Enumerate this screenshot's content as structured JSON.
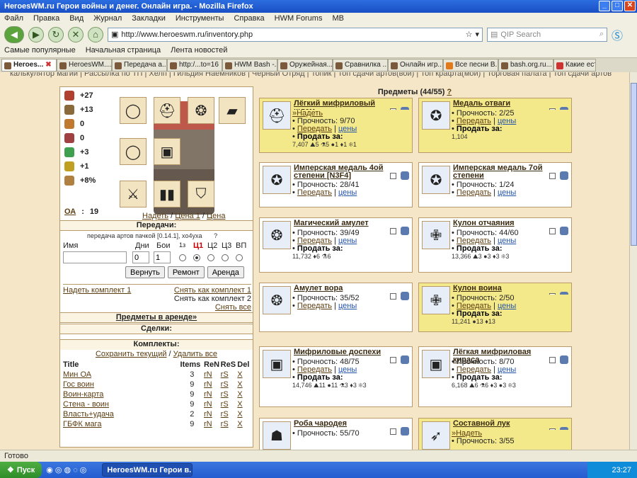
{
  "window": {
    "title": "HeroesWM.ru Герои войны и денег. Онлайн игра. - Mozilla Firefox"
  },
  "menu": [
    "Файл",
    "Правка",
    "Вид",
    "Журнал",
    "Закладки",
    "Инструменты",
    "Справка",
    "HWM Forums",
    "MB"
  ],
  "nav": {
    "url": "http://www.heroeswm.ru/inventory.php",
    "search_placeholder": "QIP Search"
  },
  "bookmarks": [
    "Самые популярные",
    "Начальная страница",
    "Лента новостей"
  ],
  "tabs": [
    "Heroes...",
    "HeroesWM....",
    "Передача а...",
    "http:/...to=16",
    "HWM Bash -...",
    "Оружейная...",
    "Сравнилка ...",
    "Онлайн игр...",
    "Все песни В...",
    "bash.org.ru...",
    "Какие ест"
  ],
  "toplinks": "калькулятор магии | Рассылка по ТП | Хелп | Гильдия Наемников | Черный Отряд | Топик | Топ сдачи артов(вои) | Топ крафта(мои) | Торговая палата | Топ сдачи артов",
  "stats": [
    {
      "icon": "attack-icon",
      "value": "+27",
      "color": "#b04030"
    },
    {
      "icon": "defense-icon",
      "value": "+13",
      "color": "#8a6a3a"
    },
    {
      "icon": "spellpower-icon",
      "value": "0",
      "color": "#c07a30"
    },
    {
      "icon": "knowledge-icon",
      "value": "0",
      "color": "#a04040"
    },
    {
      "icon": "luck-icon",
      "value": "+3",
      "color": "#40a050"
    },
    {
      "icon": "morale-icon",
      "value": "+1",
      "color": "#c0a020"
    },
    {
      "icon": "initiative-icon",
      "value": "+8%",
      "color": "#b08040"
    }
  ],
  "oa": {
    "label": "ОА",
    "value": "19"
  },
  "hero_links": {
    "wear": "Надеть",
    "price": "Цена 1",
    "price2": "Цена"
  },
  "transfer": {
    "title": "Передачи:",
    "note": "передача артов пачкой [0.14.1], xo4yxa",
    "help": "?",
    "name_label": "Имя",
    "days_label": "Дни",
    "fights_label": "Бои",
    "c1": "1з",
    "c2": "Ц1",
    "c3": "Ц2",
    "c4": "Ц3",
    "c5": "ВП",
    "days_value": "0",
    "fights_value": "1",
    "btn_return": "Вернуть",
    "btn_repair": "Ремонт",
    "btn_rent": "Аренда"
  },
  "kits_top": {
    "wear_kit": "Надеть комплект 1",
    "take_off1": "Снять как комплект 1",
    "take_off2": "Снять как комплект 2",
    "take_off_all": "Снять все"
  },
  "arena": "Предметы в аренде»",
  "deals": "Сделки:",
  "kits": {
    "title": "Комплекты:",
    "save": "Сохранить текущий",
    "delete_all": "Удалить все",
    "headers": [
      "Title",
      "Items",
      "ReN",
      "ReS",
      "Del"
    ],
    "rows": [
      {
        "title": "Мин ОА",
        "items": "3",
        "ren": "rN",
        "res": "rS",
        "del": "X"
      },
      {
        "title": "Гос воин",
        "items": "9",
        "ren": "rN",
        "res": "rS",
        "del": "X"
      },
      {
        "title": "Воин-карта",
        "items": "9",
        "ren": "rN",
        "res": "rS",
        "del": "X"
      },
      {
        "title": "Стена - воин",
        "items": "9",
        "ren": "rN",
        "res": "rS",
        "del": "X"
      },
      {
        "title": "Власть+удача",
        "items": "2",
        "ren": "rN",
        "res": "rS",
        "del": "X"
      },
      {
        "title": "ГБФК мага",
        "items": "9",
        "ren": "rN",
        "res": "rS",
        "del": "X"
      }
    ]
  },
  "items_title": "Предметы (44/55)",
  "items_help": "?",
  "items": [
    {
      "name": "Лёгкий мифриловый шлем",
      "wear": "»Надеть",
      "durability": "Прочность: 9/70",
      "transfer": "Передать",
      "prices": "цены",
      "sell": "Продать за:",
      "res": "7,407 ⛰5 ⚗5 ●1 ♦1 ❄1",
      "yellow": true,
      "icon": "helmet-icon"
    },
    {
      "name": "Медаль отваги",
      "wear": "",
      "durability": "Прочность: 2/25",
      "transfer": "Передать",
      "prices": "цены",
      "sell": "Продать за:",
      "res": "1,104",
      "yellow": true,
      "icon": "medal-icon"
    },
    {
      "name": "Имперская медаль 4ой степени [N3F4]",
      "wear": "",
      "durability": "Прочность: 28/41",
      "transfer": "Передать",
      "prices": "цены",
      "sell": "",
      "res": "",
      "yellow": false,
      "icon": "medal-icon"
    },
    {
      "name": "Имперская медаль 7ой степени",
      "wear": "",
      "durability": "Прочность: 1/24",
      "transfer": "Передать",
      "prices": "цены",
      "sell": "",
      "res": "",
      "yellow": false,
      "icon": "medal-icon"
    },
    {
      "name": "Магический амулет",
      "wear": "",
      "durability": "Прочность: 39/49",
      "transfer": "Передать",
      "prices": "цены",
      "sell": "Продать за:",
      "res": "11,732 ♦6 ⚗6",
      "yellow": false,
      "icon": "amulet-icon"
    },
    {
      "name": "Кулон отчаяния",
      "wear": "",
      "durability": "Прочность: 44/60",
      "transfer": "Передать",
      "prices": "цены",
      "sell": "Продать за:",
      "res": "13,366 ⛰3 ●3 ♦3 ❄3",
      "yellow": false,
      "icon": "pendant-icon"
    },
    {
      "name": "Амулет вора",
      "wear": "",
      "durability": "Прочность: 35/52",
      "transfer": "Передать",
      "prices": "цены",
      "sell": "",
      "res": "",
      "yellow": false,
      "icon": "amulet-icon"
    },
    {
      "name": "Кулон воина",
      "wear": "",
      "durability": "Прочность: 2/50",
      "transfer": "Передать",
      "prices": "цены",
      "sell": "Продать за:",
      "res": "11,241 ●13 ♦13",
      "yellow": true,
      "icon": "pendant-icon"
    },
    {
      "name": "Мифриловые доспехи",
      "wear": "",
      "durability": "Прочность: 48/75",
      "transfer": "Передать",
      "prices": "цены",
      "sell": "Продать за:",
      "res": "14,746 ⛰11 ●11 ⚗3 ♦3 ❄3",
      "yellow": false,
      "icon": "armor-icon"
    },
    {
      "name": "Лёгкая мифриловая кираса",
      "wear": "",
      "durability": "Прочность: 8/70",
      "transfer": "Передать",
      "prices": "цены",
      "sell": "Продать за:",
      "res": "6,168 ⛰6 ⚗6 ♦3 ●3 ❄3",
      "yellow": false,
      "icon": "armor-icon"
    },
    {
      "name": "Роба чародея",
      "wear": "",
      "durability": "Прочность: 55/70",
      "transfer": "",
      "prices": "",
      "sell": "",
      "res": "",
      "yellow": false,
      "icon": "robe-icon"
    },
    {
      "name": "Составной лук",
      "wear": "»Надеть",
      "durability": "Прочность: 3/55",
      "transfer": "",
      "prices": "",
      "sell": "",
      "res": "",
      "yellow": true,
      "icon": "bow-icon"
    }
  ],
  "status": "Готово",
  "taskbar": {
    "start": "Пуск",
    "window": "HeroesWM.ru Герои в...",
    "clock": "23:27"
  }
}
